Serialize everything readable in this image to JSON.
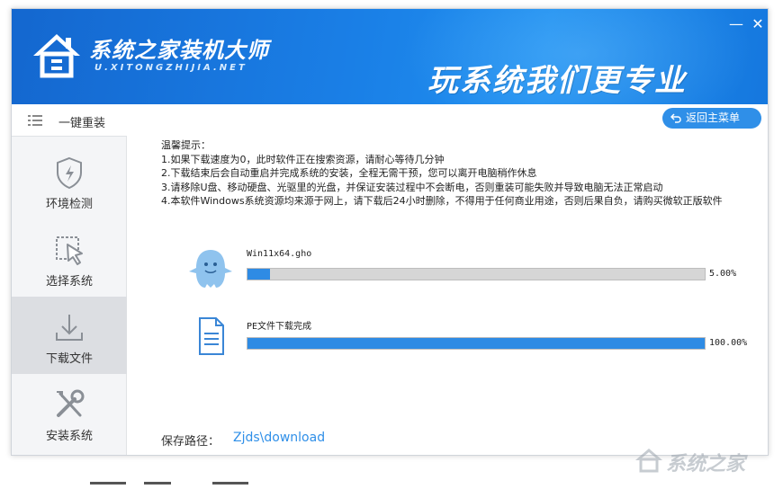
{
  "header": {
    "brand_name": "系统之家装机大师",
    "brand_url": "U.XITONGZHIJIA.NET",
    "slogan": "玩系统我们更专业",
    "minimize_symbol": "—",
    "close_symbol": "✕"
  },
  "sidebar": {
    "top_label": "一键重装",
    "items": [
      {
        "label": "环境检测",
        "icon": "shield-icon"
      },
      {
        "label": "选择系统",
        "icon": "cursor-select-icon"
      },
      {
        "label": "下载文件",
        "icon": "download-icon",
        "active": true
      },
      {
        "label": "安装系统",
        "icon": "tools-icon"
      }
    ]
  },
  "main": {
    "back_button": "返回主菜单",
    "notice": {
      "title": "温馨提示：",
      "lines": [
        "1.如果下载速度为0，此时软件正在搜索资源，请耐心等待几分钟",
        "2.下载结束后会自动重启并完成系统的安装，全程无需干预，您可以离开电脑稍作休息",
        "3.请移除U盘、移动硬盘、光驱里的光盘，并保证安装过程中不会断电，否则重装可能失败并导致电脑无法正常启动",
        "4.本软件Windows系统资源均来源于网上，请下载后24小时删除，不得用于任何商业用途，否则后果自负，请购买微软正版软件"
      ]
    },
    "downloads": [
      {
        "name": "Win11x64.gho",
        "percent_text": "5.00%",
        "progress": 0.05,
        "icon": "ghost-icon"
      },
      {
        "name": "PE文件下载完成",
        "percent_text": "100.00%",
        "progress": 1.0,
        "icon": "document-icon"
      }
    ],
    "save_path_label": "保存路径：",
    "save_path_value": "Zjds\\download"
  },
  "watermark": {
    "text": "系统之家"
  },
  "colors": {
    "header_blue": "#1a7fe6",
    "accent_blue": "#2e8be4",
    "link_blue": "#2f8fe8",
    "sidebar_bg": "#f4f5f7",
    "sidebar_active": "#dcdee2"
  }
}
